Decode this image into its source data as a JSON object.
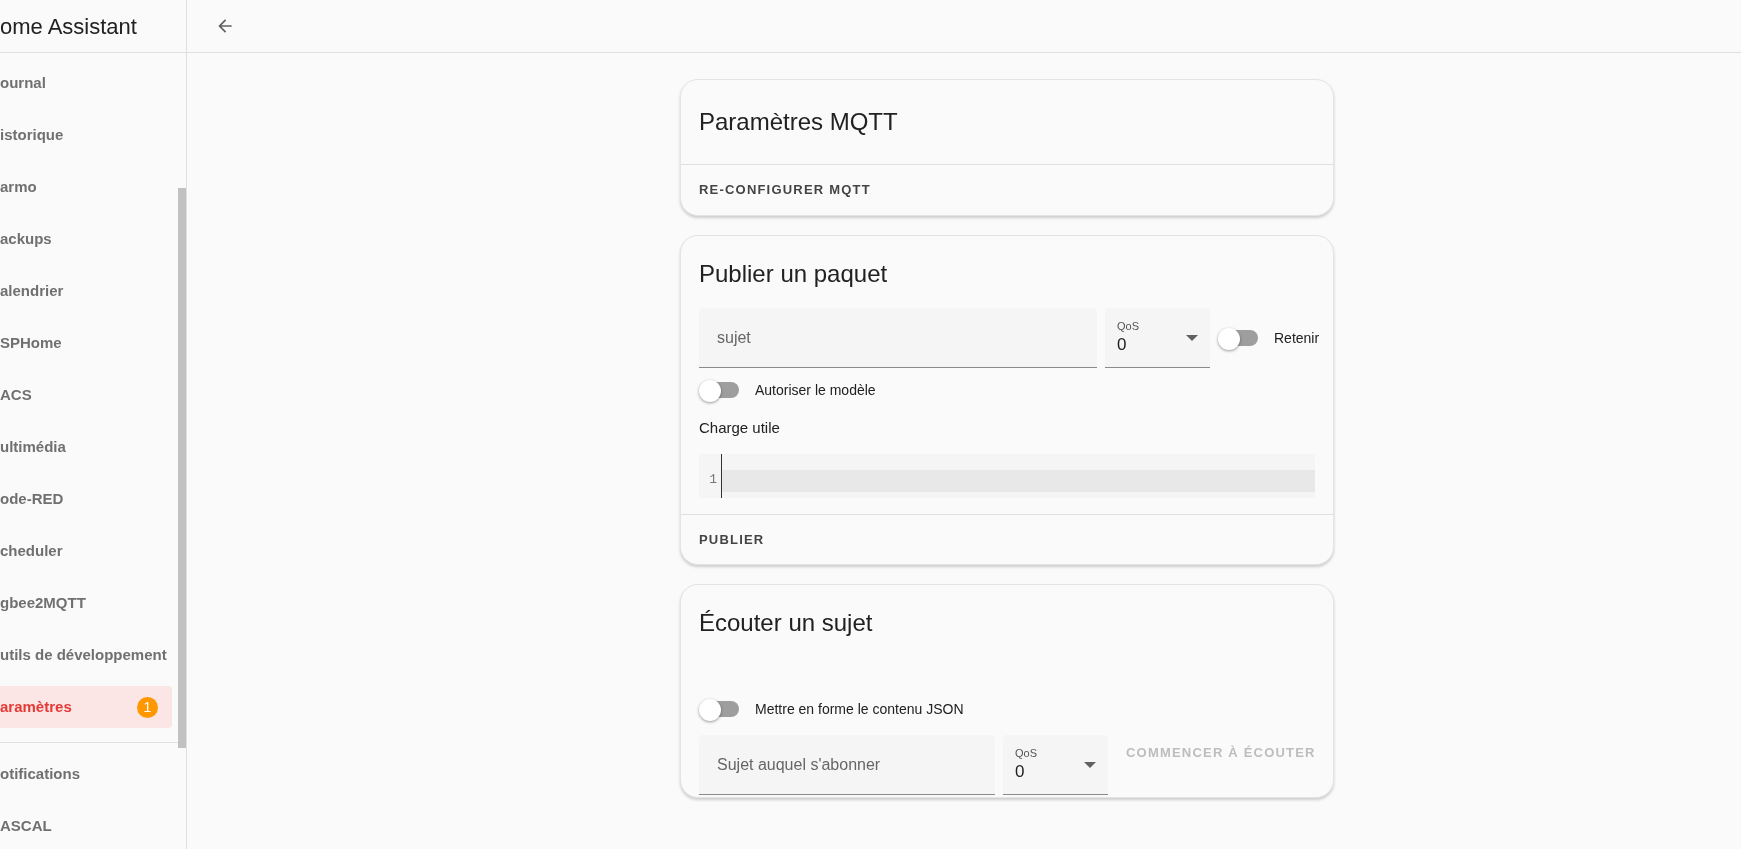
{
  "sidebar": {
    "title": "ome Assistant",
    "items": [
      {
        "label": "ournal",
        "selected": false
      },
      {
        "label": "istorique",
        "selected": false
      },
      {
        "label": "armo",
        "selected": false
      },
      {
        "label": "ackups",
        "selected": false
      },
      {
        "label": "alendrier",
        "selected": false
      },
      {
        "label": "SPHome",
        "selected": false
      },
      {
        "label": "ACS",
        "selected": false
      },
      {
        "label": "ultimédia",
        "selected": false
      },
      {
        "label": "ode-RED",
        "selected": false
      },
      {
        "label": "cheduler",
        "selected": false
      },
      {
        "label": "gbee2MQTT",
        "selected": false
      },
      {
        "label": "utils de développement",
        "selected": false
      },
      {
        "label": "aramètres",
        "selected": true,
        "badge": "1"
      }
    ],
    "bottom_items": [
      {
        "label": "otifications"
      },
      {
        "label": "ASCAL"
      }
    ]
  },
  "settings_card": {
    "title": "Paramètres MQTT",
    "button": "RE-CONFIGURER MQTT"
  },
  "publish_card": {
    "title": "Publier un paquet",
    "topic_field": {
      "placeholder": "sujet"
    },
    "qos": {
      "label": "QoS",
      "value": "0"
    },
    "retain_toggle": {
      "label": "Retenir",
      "on": false
    },
    "template_toggle": {
      "label": "Autoriser le modèle",
      "on": false
    },
    "payload_label": "Charge utile",
    "editor_lines": [
      "1"
    ],
    "button": "PUBLIER"
  },
  "listen_card": {
    "title": "Écouter un sujet",
    "json_toggle": {
      "label": "Mettre en forme le contenu JSON",
      "on": false
    },
    "topic_field": {
      "placeholder": "Sujet auquel s'abonner"
    },
    "qos": {
      "label": "QoS",
      "value": "0"
    },
    "button": {
      "label": "COMMENCER À ÉCOUTER",
      "disabled": true
    }
  }
}
